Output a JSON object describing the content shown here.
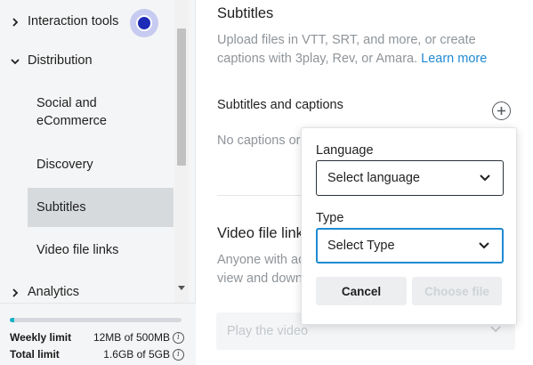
{
  "sidebar": {
    "items": [
      {
        "label": "Interaction tools",
        "expanded": false
      },
      {
        "label": "Distribution",
        "expanded": true
      },
      {
        "label": "Analytics",
        "expanded": false
      }
    ],
    "sub_items": [
      {
        "label": "Social and eCommerce"
      },
      {
        "label": "Discovery"
      },
      {
        "label": "Subtitles",
        "active": true
      },
      {
        "label": "Video file links"
      }
    ],
    "limits": {
      "progress_fraction": 0.024,
      "weekly_label": "Weekly limit",
      "weekly_value": "12MB of 500MB",
      "total_label": "Total limit",
      "total_value": "1.6GB of 5GB"
    }
  },
  "main": {
    "title": "Subtitles",
    "description": "Upload files in VTT, SRT, and more, or create captions with 3play, Rev, or Amara.",
    "learn_more": "Learn more",
    "subtitles_heading": "Subtitles and captions",
    "no_captions_text": "No captions or",
    "video_file_links_title": "Video file link",
    "video_file_links_desc": "Anyone with ac view and down",
    "play_select_placeholder": "Play the video"
  },
  "popover": {
    "language_label": "Language",
    "language_placeholder": "Select language",
    "type_label": "Type",
    "type_placeholder": "Select Type",
    "cancel_label": "Cancel",
    "choose_file_label": "Choose file"
  },
  "colors": {
    "accent": "#1f8ad3",
    "progress": "#17b3c9",
    "focus_dot": "#1d2bb7"
  },
  "icons": [
    "chevron-right-icon",
    "chevron-down-icon",
    "plus-circle-icon",
    "info-icon"
  ]
}
